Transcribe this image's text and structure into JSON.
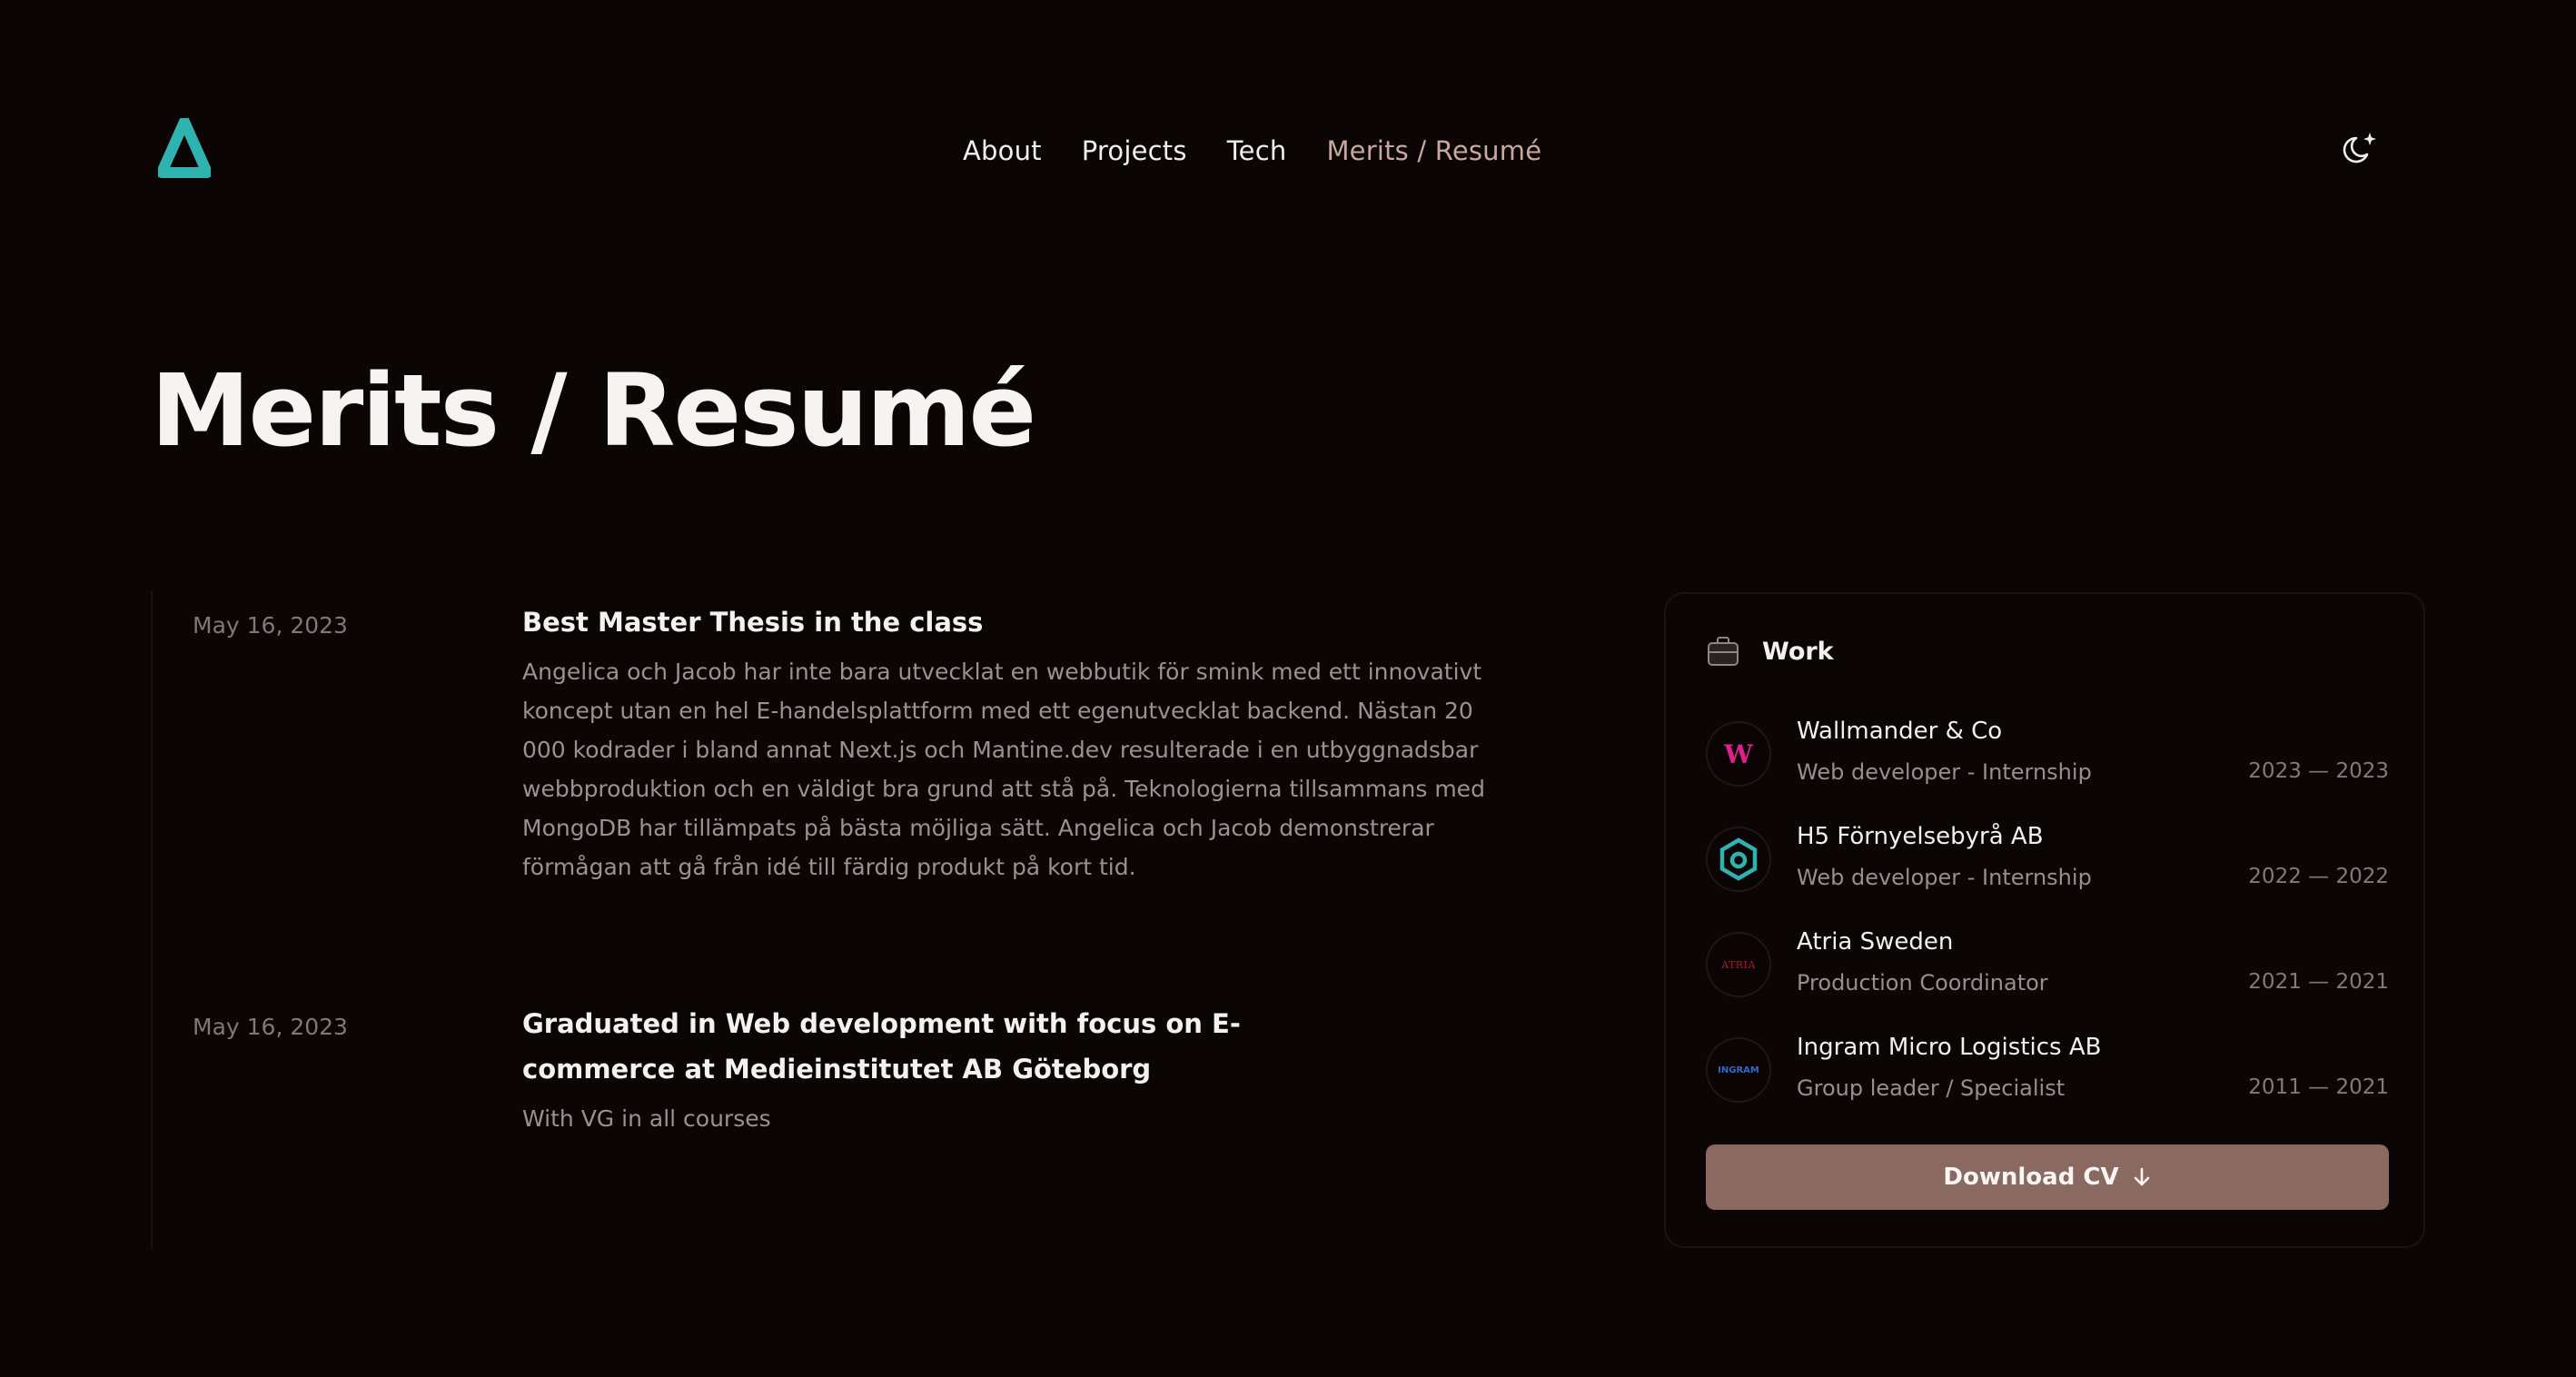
{
  "header": {
    "logo_icon": "triangle-logo-icon",
    "nav": [
      {
        "label": "About"
      },
      {
        "label": "Projects"
      },
      {
        "label": "Tech"
      },
      {
        "label": "Merits / Resumé",
        "active": true
      }
    ],
    "theme_toggle_icon": "moon-sparkle-icon"
  },
  "main": {
    "title": "Merits / Resumé",
    "timeline": [
      {
        "date": "May 16, 2023",
        "title": "Best Master Thesis in the class",
        "description": "Angelica och Jacob har inte bara utvecklat en webbutik för smink med ett innovativt koncept utan en hel E-handelsplattform med ett egenutvecklat backend. Nästan 20 000 kodrader i bland annat Next.js och Mantine.dev resulterade i en utbyggnadsbar webbproduktion och en väldigt bra grund att stå på. Teknologierna tillsammans med MongoDB har tillämpats på bästa möjliga sätt. Angelica och Jacob demonstrerar förmågan att gå från idé till färdig produkt på kort tid."
      },
      {
        "date": "May 16, 2023",
        "title": "Graduated in Web development with focus on E-commerce at Medieinstitutet AB Göteborg",
        "description": "With VG in all courses"
      }
    ]
  },
  "work": {
    "label": "Work",
    "icon": "briefcase-icon",
    "jobs": [
      {
        "company": "Wallmander & Co",
        "role": "Web developer - Internship",
        "period": "2023 — 2023",
        "logo": "wallmander-logo-icon",
        "logo_text": "W",
        "logo_color": "#e0208a"
      },
      {
        "company": "H5 Förnyelsebyrå AB",
        "role": "Web developer - Internship",
        "period": "2022 — 2022",
        "logo": "h5-logo-icon",
        "logo_color": "#2fb3b0"
      },
      {
        "company": "Atria Sweden",
        "role": "Production Coordinator",
        "period": "2021 — 2021",
        "logo": "atria-logo-icon",
        "logo_text": "ATRIA",
        "logo_color": "#b01b2a"
      },
      {
        "company": "Ingram Micro Logistics AB",
        "role": "Group leader / Specialist",
        "period": "2011 — 2021",
        "logo": "ingram-logo-icon",
        "logo_text": "INGRAM",
        "logo_color": "#3566c9"
      }
    ],
    "download_label": "Download CV",
    "download_icon": "arrow-down-icon"
  },
  "colors": {
    "background": "#0c0505",
    "accent_logo": "#2fb3b0",
    "nav_active": "#c8a89d",
    "button": "#8a6a60"
  }
}
